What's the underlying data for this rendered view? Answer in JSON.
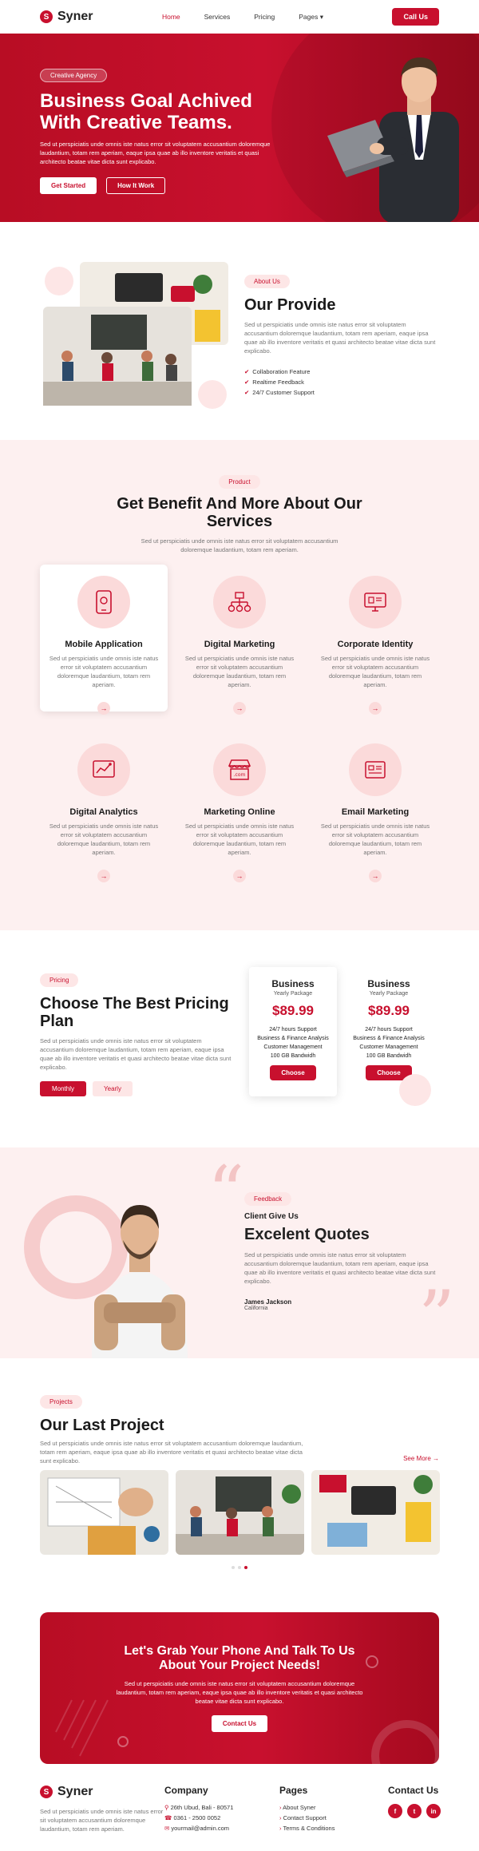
{
  "nav": {
    "brand": "Syner",
    "brand_mark": "S",
    "items": [
      "Home",
      "Services",
      "Pricing",
      "Pages"
    ],
    "cta": "Call Us"
  },
  "hero": {
    "tag": "Creative Agency",
    "title": "Business Goal Achived With Creative Teams.",
    "text": "Sed ut perspiciatis unde omnis iste natus error sit voluptatem accusantium doloremque laudantium, totam rem aperiam, eaque ipsa quae ab illo inventore veritatis et quasi architecto beatae vitae dicta sunt explicabo.",
    "primary": "Get Started",
    "secondary": "How It Work"
  },
  "about": {
    "tag": "About Us",
    "title": "Our Provide",
    "text": "Sed ut perspiciatis unde omnis iste natus error sit voluptatem accusantium doloremque laudantium, totam rem aperiam, eaque ipsa quae ab illo inventore veritatis et quasi architecto beatae vitae dicta sunt explicabo.",
    "features": [
      "Collaboration Feature",
      "Realtime Feedback",
      "24/7 Customer Support"
    ]
  },
  "services": {
    "tag": "Product",
    "title": "Get Benefit And More About Our Services",
    "text": "Sed ut perspiciatis unde omnis iste natus error sit voluptatem accusantium doloremque laudantium, totam rem aperiam.",
    "card_text": "Sed ut perspiciatis unde omnis iste natus error sit voluptatem accusantium doloremque laudantium, totam rem aperiam.",
    "items": [
      {
        "title": "Mobile Application",
        "icon": "mobile-icon"
      },
      {
        "title": "Digital Marketing",
        "icon": "sitemap-icon"
      },
      {
        "title": "Corporate Identity",
        "icon": "monitor-icon"
      },
      {
        "title": "Digital Analytics",
        "icon": "analytics-icon"
      },
      {
        "title": "Marketing Online",
        "icon": "store-icon"
      },
      {
        "title": "Email Marketing",
        "icon": "email-icon"
      }
    ]
  },
  "pricing": {
    "tag": "Pricing",
    "title": "Choose The Best Pricing Plan",
    "text": "Sed ut perspiciatis unde omnis iste natus error sit voluptatem accusantium doloremque laudantium, totam rem aperiam, eaque ipsa quae ab illo inventore veritatis et quasi architecto beatae vitae dicta sunt explicabo.",
    "monthly": "Monthly",
    "yearly": "Yearly",
    "plans": [
      {
        "name": "Business",
        "package": "Yearly Package",
        "price": "$89.99",
        "features": [
          "24/7 hours Support",
          "Business & Finance Analysis",
          "Customer Management",
          "100 GB Bandwidh"
        ],
        "button": "Choose"
      },
      {
        "name": "Business",
        "package": "Yearly Package",
        "price": "$89.99",
        "features": [
          "24/7 hours Support",
          "Business & Finance Analysis",
          "Customer Management",
          "100 GB Bandwidh"
        ],
        "button": "Choose"
      }
    ]
  },
  "testimonial": {
    "tag": "Feedback",
    "label": "Client Give Us",
    "title": "Excelent Quotes",
    "text": "Sed ut perspiciatis unde omnis iste natus error sit voluptatem accusantium doloremque laudantium, totam rem aperiam, eaque ipsa quae ab illo inventore veritatis et quasi architecto beatae vitae dicta sunt explicabo.",
    "name": "James Jackson",
    "city": "California"
  },
  "projects": {
    "tag": "Projects",
    "title": "Our Last Project",
    "text": "Sed ut perspiciatis unde omnis iste natus error sit voluptatem accusantium doloremque laudantium, totam rem aperiam, eaque ipsa quae ab illo inventore veritatis et quasi architecto beatae vitae dicta sunt explicabo.",
    "more": "See More"
  },
  "cta": {
    "title": "Let's Grab Your Phone And Talk To Us About Your Project Needs!",
    "text": "Sed ut perspiciatis unde omnis iste natus error sit voluptatem accusantium doloremque laudantium, totam rem aperiam, eaque ipsa quae ab illo inventore veritatis et quasi architecto beatae vitae dicta sunt explicabo.",
    "button": "Contact Us"
  },
  "footer": {
    "brand": "Syner",
    "text": "Sed ut perspiciatis unde omnis iste natus error sit voluptatem accusantium doloremque laudantium, totam rem aperiam.",
    "company_title": "Company",
    "company": [
      "26th Ubud, Bali - 80571",
      "0361 - 2500 0052",
      "yourmail@admin.com"
    ],
    "pages_title": "Pages",
    "pages": [
      "About Syner",
      "Contact Support",
      "Terms & Conditions"
    ],
    "contact_title": "Contact Us"
  }
}
